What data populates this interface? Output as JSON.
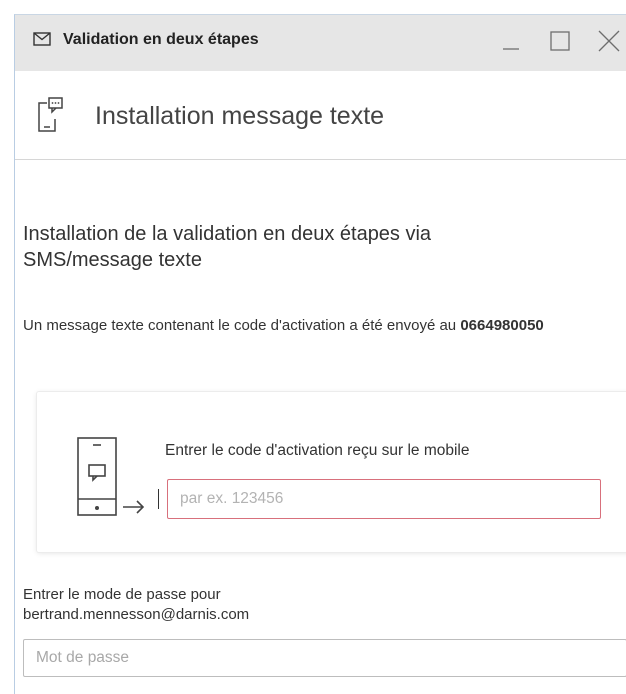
{
  "window": {
    "title": "Validation en deux étapes",
    "title_icon": "mail-icon",
    "controls": [
      "minimize-icon",
      "maximize-icon",
      "close-icon"
    ]
  },
  "header": {
    "icon": "sms-phone-icon",
    "title": "Installation message texte"
  },
  "section": {
    "title_line1": "Installation de la validation en deux étapes via",
    "title_line2": "SMS/message texte"
  },
  "info": {
    "text_before": "Un message texte contenant le code d'activation a été envoyé au ",
    "phone_number": "0664980050"
  },
  "activation": {
    "icon": "phone-arrow-icon",
    "label": "Entrer le code d'activation reçu sur le mobile",
    "value": "",
    "placeholder": "par ex. 123456"
  },
  "password": {
    "label_line1": "Entrer le mode de passe pour",
    "label_line2": "bertrand.mennesson@darnis.com",
    "value": "",
    "placeholder": "Mot de passe"
  },
  "colors": {
    "titlebar": "#e6e6e6",
    "input_error_border": "#d8707c",
    "text": "#333333"
  }
}
